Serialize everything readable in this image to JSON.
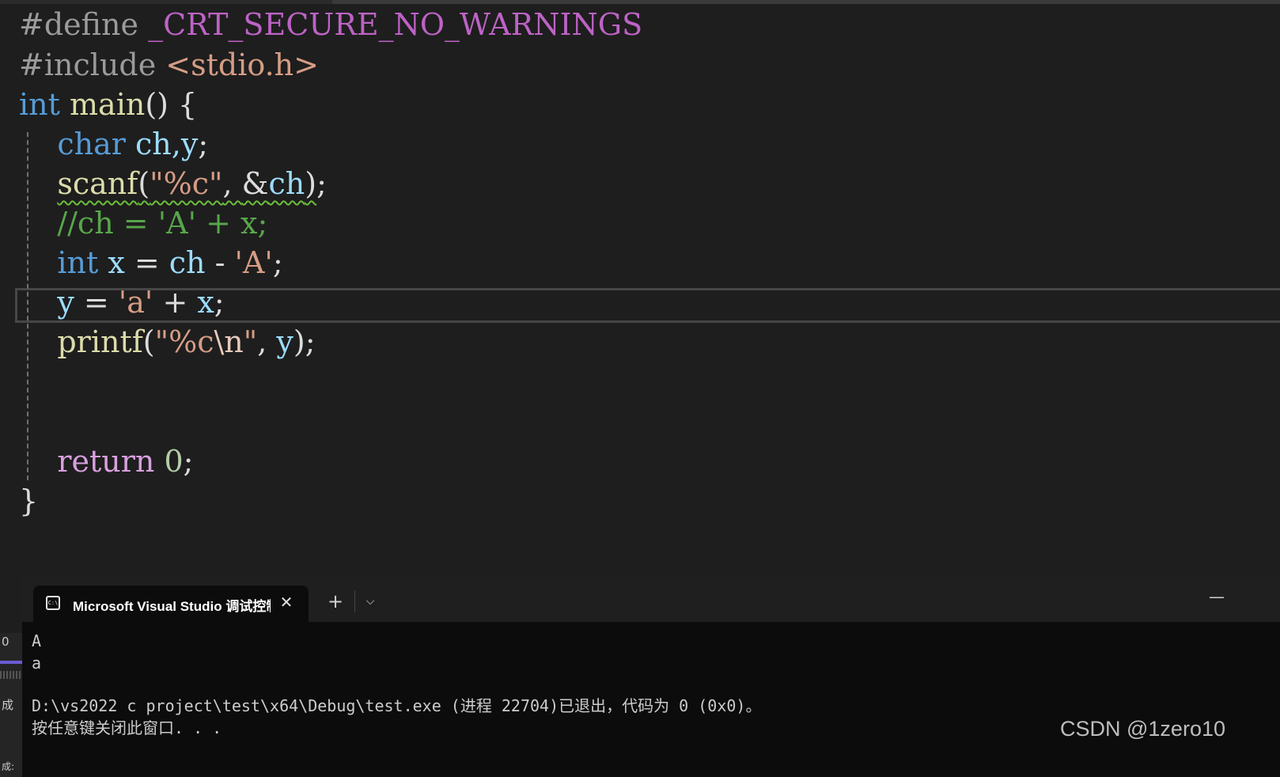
{
  "editor": {
    "line1": {
      "directive": "#define",
      "macro": "_CRT_SECURE_NO_WARNINGS"
    },
    "line2": {
      "directive": "#include",
      "header": "<stdio.h>"
    },
    "line3": {
      "type": "int",
      "name": "main",
      "rest": "() {"
    },
    "line4": {
      "type": "char",
      "vars": "ch,",
      "var2": "y",
      "semi": ";"
    },
    "line5": {
      "fn": "scanf",
      "open": "(",
      "fmt": "\"%c\"",
      "sep": ", ",
      "amp": "&",
      "arg": "ch",
      "close": ")",
      "semi": ";"
    },
    "line6": {
      "comment": "//ch = 'A' + x;"
    },
    "line7": {
      "type": "int",
      "var": "x",
      "eq": " = ",
      "rhs_var": "ch",
      "op": " - ",
      "char": "'A'",
      "semi": ";"
    },
    "line8": {
      "var": "y",
      "eq": " = ",
      "char": "'a'",
      "op": " + ",
      "rhs_var": "x",
      "semi": ";"
    },
    "line9": {
      "fn": "printf",
      "open": "(",
      "fmt_a": "\"%c",
      "esc": "\\n",
      "fmt_b": "\"",
      "sep": ", ",
      "arg": "y",
      "close": ")",
      "semi": ";"
    },
    "line12": {
      "kw": "return",
      "num": "0",
      "semi": ";"
    },
    "line13": {
      "brace": "}"
    }
  },
  "terminal": {
    "tab_title": "Microsoft Visual Studio 调试控制台",
    "tab_icon_text": "C:\\",
    "close_symbol": "✕",
    "new_tab_symbol": "+",
    "dropdown_symbol": "⌵",
    "minimize_symbol": "—",
    "output": [
      "A",
      "a",
      "",
      "D:\\vs2022 c project\\test\\x64\\Debug\\test.exe (进程 22704)已退出，代码为 0 (0x0)。",
      "按任意键关闭此窗口. . ."
    ]
  },
  "left_panel": {
    "fragments": [
      "0",
      "成",
      "成: "
    ]
  },
  "watermark": "CSDN @1zero10"
}
